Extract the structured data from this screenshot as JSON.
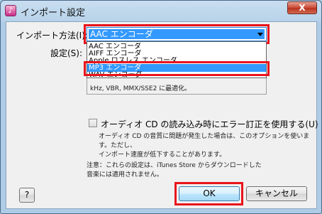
{
  "window": {
    "title": "インポート設定",
    "app_icon_glyph": "♪",
    "close_glyph": "X"
  },
  "import_method": {
    "label": "インポート方法(I):",
    "selected": "AAC エンコーダ"
  },
  "settings": {
    "label": "設定(S):"
  },
  "info": {
    "text": "kHz, VBR, MMX/SSE2 に最適化。"
  },
  "dropdown": {
    "options": [
      "AAC エンコーダ",
      "AIFF エンコーダ",
      "Apple ロスレス エンコーダ",
      "MP3 エンコーダ",
      "WAV エンコーダ"
    ],
    "highlighted_index": 3
  },
  "error_correction": {
    "label": "オーディオ CD の読み込み時にエラー訂正を使用する(U)",
    "checked": false,
    "description_line1": "オーディオ CD の音質に問題が発生した場合は、このオプションを使います。ただし、",
    "description_line2": "インポート速度が低下することがあります。"
  },
  "note": {
    "line1": "注意：これらの設定は、iTunes Store からダウンロードした",
    "line2": "音楽には適用されません。"
  },
  "buttons": {
    "help": "?",
    "ok": "OK",
    "cancel": "キャンセル"
  },
  "colors": {
    "highlight_red": "#e8141c",
    "selection_blue": "#3399ff"
  }
}
